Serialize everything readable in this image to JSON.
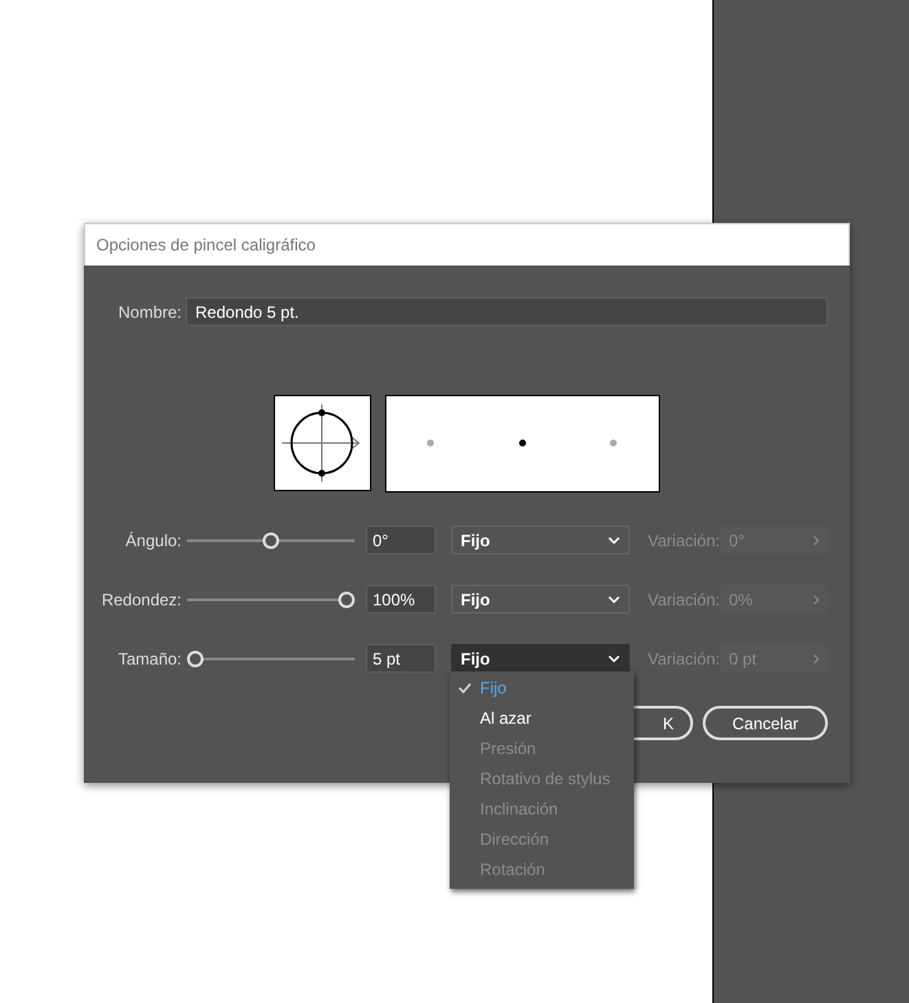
{
  "window": {
    "title": "Opciones de pincel caligráfico"
  },
  "name": {
    "label": "Nombre:",
    "value": "Redondo 5 pt."
  },
  "controls": [
    {
      "label": "Ángulo:",
      "level": 0.5,
      "value": "0°",
      "mode": "Fijo",
      "open": false,
      "variation_label": "Variación:",
      "variation_value": "0°",
      "variation_disabled": true
    },
    {
      "label": "Redondez:",
      "level": 1,
      "value": "100%",
      "mode": "Fijo",
      "open": false,
      "variation_label": "Variación:",
      "variation_value": "0%",
      "variation_disabled": true
    },
    {
      "label": "Tamaño:",
      "level": 0,
      "value": "5 pt",
      "mode": "Fijo",
      "open": true,
      "variation_label": "Variación:",
      "variation_value": "0 pt",
      "variation_disabled": true
    }
  ],
  "menu": {
    "items": [
      {
        "label": "Fijo",
        "selected": true,
        "disabled": false
      },
      {
        "label": "Al azar",
        "selected": false,
        "disabled": false
      },
      {
        "label": "Presión",
        "selected": false,
        "disabled": true
      },
      {
        "label": "Rotativo de stylus",
        "selected": false,
        "disabled": true
      },
      {
        "label": "Inclinación",
        "selected": false,
        "disabled": true
      },
      {
        "label": "Dirección",
        "selected": false,
        "disabled": true
      },
      {
        "label": "Rotación",
        "selected": false,
        "disabled": true
      }
    ]
  },
  "buttons": [
    {
      "label": "K",
      "kind": "primary"
    },
    {
      "label": "Cancelar",
      "kind": "secondary"
    }
  ]
}
